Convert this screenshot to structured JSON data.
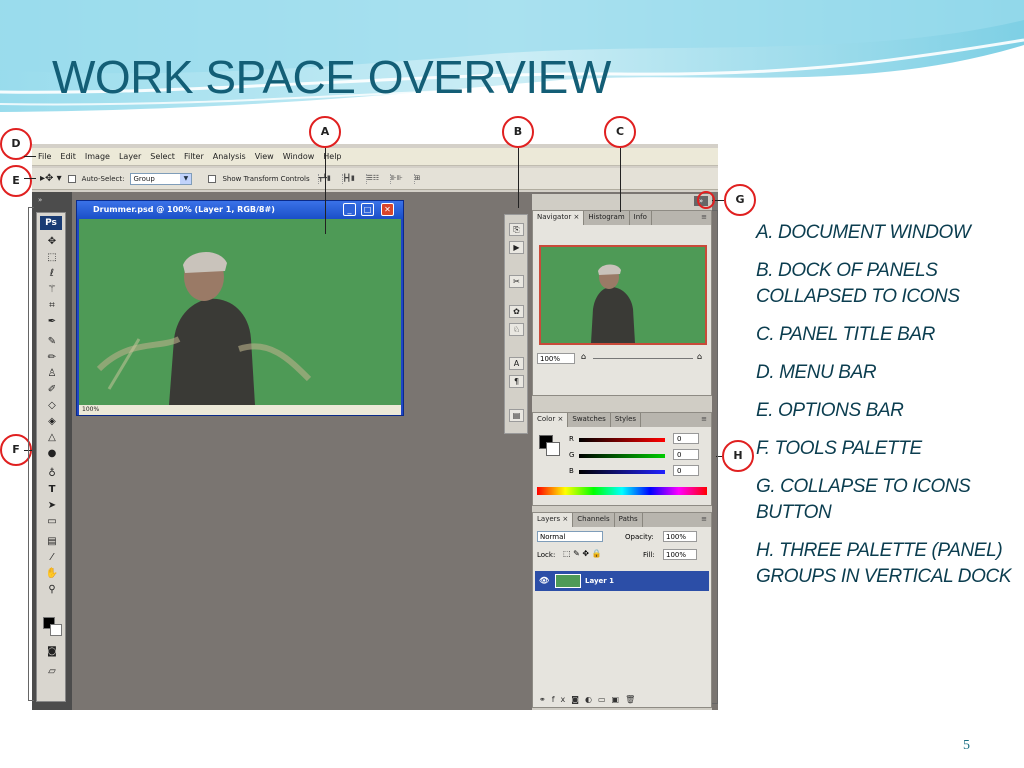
{
  "slide": {
    "title": "WORK SPACE OVERVIEW",
    "page_number": "5"
  },
  "legend": [
    "A. DOCUMENT WINDOW",
    "B. DOCK OF PANELS COLLAPSED TO ICONS",
    "C. PANEL TITLE BAR",
    "D. MENU BAR",
    "E. OPTIONS BAR",
    "F. TOOLS PALETTE",
    "G. COLLAPSE TO ICONS BUTTON",
    "H. THREE PALETTE (PANEL) GROUPS IN VERTICAL DOCK"
  ],
  "callouts": {
    "a": "A",
    "b": "B",
    "c": "C",
    "d": "D",
    "e": "E",
    "f": "F",
    "g": "G",
    "h": "H"
  },
  "menubar": {
    "items": [
      "File",
      "Edit",
      "Image",
      "Layer",
      "Select",
      "Filter",
      "Analysis",
      "View",
      "Window",
      "Help"
    ]
  },
  "optionsbar": {
    "auto_select_label": "Auto-Select:",
    "auto_select_value": "Group",
    "show_transform_label": "Show Transform Controls"
  },
  "tools": {
    "ps_logo": "Ps"
  },
  "document": {
    "title": "Drummer.psd @ 100% (Layer 1, RGB/8#)",
    "zoom": "100%"
  },
  "navigator_panel": {
    "tabs": [
      "Navigator ×",
      "Histogram",
      "Info"
    ],
    "zoom": "100%"
  },
  "color_panel": {
    "tabs": [
      "Color ×",
      "Swatches",
      "Styles"
    ],
    "r_label": "R",
    "g_label": "G",
    "b_label": "B",
    "r_value": "0",
    "g_value": "0",
    "b_value": "0"
  },
  "layers_panel": {
    "tabs": [
      "Layers ×",
      "Channels",
      "Paths"
    ],
    "blend_mode": "Normal",
    "opacity_label": "Opacity:",
    "opacity_value": "100%",
    "lock_label": "Lock:",
    "fill_label": "Fill:",
    "fill_value": "100%",
    "layer_name": "Layer 1"
  },
  "colors": {
    "title_teal": "#135e76",
    "legend_text": "#0b3d4f",
    "callout_red": "#e02020",
    "canvas_green": "#4e9a56",
    "workspace_gray": "#7a7571"
  }
}
